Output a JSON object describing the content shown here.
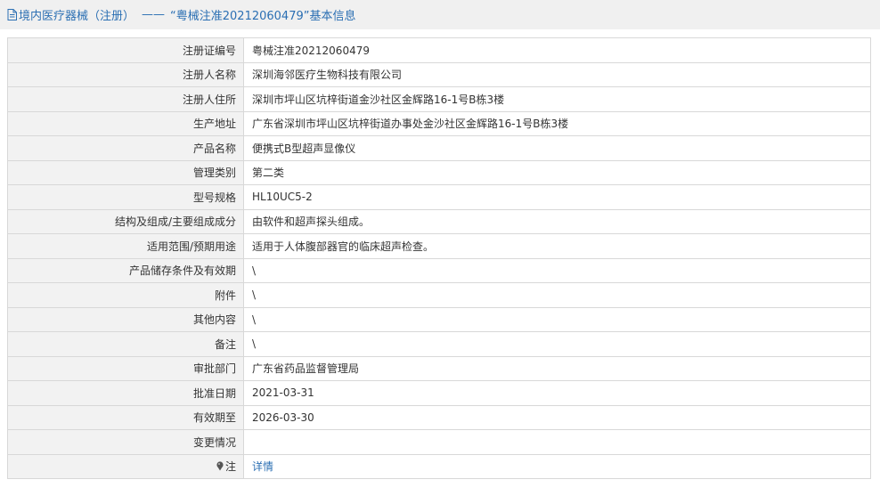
{
  "header": {
    "category": "境内医疗器械（注册）",
    "separator": "——",
    "title": "“粤械注准20212060479”基本信息",
    "icon": "document-icon",
    "color": "#2b6fb3"
  },
  "fields": [
    {
      "label": "注册证编号",
      "value": "粤械注准20212060479"
    },
    {
      "label": "注册人名称",
      "value": "深圳海邻医疗生物科技有限公司"
    },
    {
      "label": "注册人住所",
      "value": "深圳市坪山区坑梓街道金沙社区金辉路16-1号B栋3楼"
    },
    {
      "label": "生产地址",
      "value": "广东省深圳市坪山区坑梓街道办事处金沙社区金辉路16-1号B栋3楼"
    },
    {
      "label": "产品名称",
      "value": "便携式B型超声显像仪"
    },
    {
      "label": "管理类别",
      "value": "第二类"
    },
    {
      "label": "型号规格",
      "value": "HL10UC5-2"
    },
    {
      "label": "结构及组成/主要组成成分",
      "value": "由软件和超声探头组成。"
    },
    {
      "label": "适用范围/预期用途",
      "value": "适用于人体腹部器官的临床超声检查。"
    },
    {
      "label": "产品储存条件及有效期",
      "value": "\\"
    },
    {
      "label": "附件",
      "value": "\\"
    },
    {
      "label": "其他内容",
      "value": "\\"
    },
    {
      "label": "备注",
      "value": "\\"
    },
    {
      "label": "审批部门",
      "value": "广东省药品监督管理局"
    },
    {
      "label": "批准日期",
      "value": "2021-03-31"
    },
    {
      "label": "有效期至",
      "value": "2026-03-30"
    },
    {
      "label": "变更情况",
      "value": ""
    }
  ],
  "note": {
    "label": "注",
    "icon": "pin-icon",
    "link_text": "详情"
  }
}
